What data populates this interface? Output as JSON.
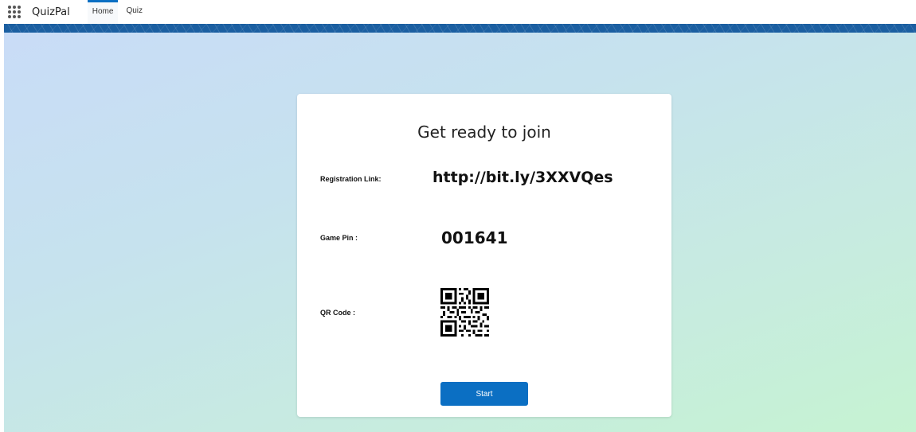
{
  "header": {
    "app_name": "QuizPal",
    "tabs": [
      {
        "label": "Home",
        "active": true
      },
      {
        "label": "Quiz",
        "active": false
      }
    ]
  },
  "card": {
    "title": "Get ready to join",
    "registration": {
      "label": "Registration Link:",
      "value": "http://bit.ly/3XXVQes"
    },
    "game_pin": {
      "label": "Game Pin :",
      "value": "001641"
    },
    "qr": {
      "label": "QR Code :"
    },
    "start_button": "Start"
  },
  "colors": {
    "accent": "#0b6fc3",
    "banner": "#1b5fa1",
    "bg_start": "#c9dcf7",
    "bg_end": "#c6f3d2"
  }
}
